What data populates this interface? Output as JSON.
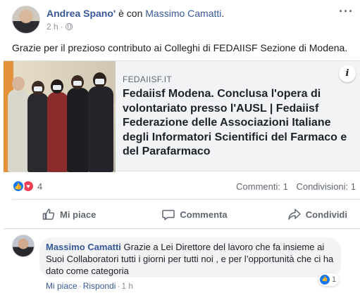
{
  "post": {
    "author": "Andrea Spano'",
    "with_text": " è con ",
    "tagged": "Massimo Camatti",
    "tagged_suffix": ".",
    "time": "2 h",
    "meta_sep": "·",
    "privacy_icon": "globe-icon",
    "more_label": "···",
    "text": "Grazie per il prezioso contributo ai Colleghi di FEDAIISF Sezione di Modena."
  },
  "link": {
    "domain": "FEDAIISF.IT",
    "title": "Fedaiisf Modena. Conclusa l'opera di volontariato presso l'AUSL | Fedaiisf Federazione delle Associazioni Italiane degli Informatori Scientifici del Farmaco e del Parafarmaco",
    "info_label": "i"
  },
  "reactions": {
    "count": "4",
    "like_glyph": "👍",
    "love_glyph": "♥",
    "comments": "Commenti: 1",
    "shares": "Condivisioni: 1"
  },
  "actions": {
    "like": "Mi piace",
    "comment": "Commenta",
    "share": "Condividi"
  },
  "comment": {
    "author": "Massimo Camatti",
    "text": " Grazie a Lei Direttore del lavoro che fa insieme ai Suoi Collaboratori tutti i giorni per tutti noi , e per l’opportunità che ci ha dato come categoria",
    "reaction_count": "1",
    "like_action": "Mi piace",
    "reply_action": "Rispondi",
    "sep": "·",
    "time": "1 h"
  },
  "colors": {
    "link_blue": "#385898",
    "like_blue": "#1877f2",
    "love_red": "#f33e58",
    "muted": "#606770",
    "card_bg": "#f2f3f5"
  }
}
